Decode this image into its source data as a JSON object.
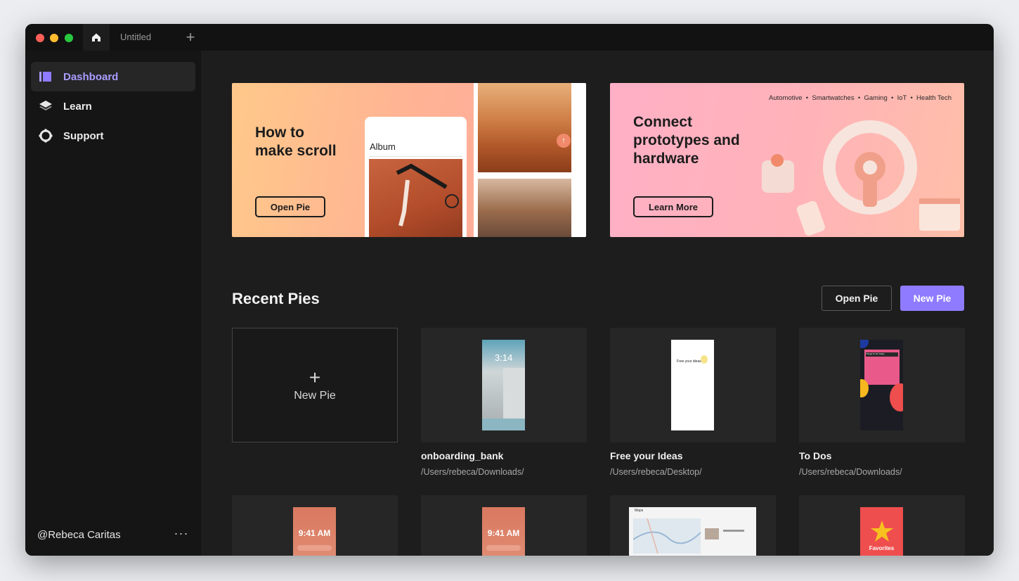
{
  "window": {
    "tab_title": "Untitled",
    "colors": {
      "close": "#ff5f57",
      "minimize": "#febc2e",
      "zoom": "#28c840",
      "accent": "#8e7bff"
    }
  },
  "sidebar": {
    "items": [
      {
        "label": "Dashboard",
        "icon": "dashboard-icon",
        "active": true
      },
      {
        "label": "Learn",
        "icon": "layers-icon",
        "active": false
      },
      {
        "label": "Support",
        "icon": "lifebuoy-icon",
        "active": false
      }
    ],
    "user": "@Rebeca Caritas",
    "more": "···"
  },
  "banners": [
    {
      "title_line1": "How to",
      "title_line2": "make scroll",
      "button": "Open Pie",
      "album_label": "Album"
    },
    {
      "title_line1": "Connect",
      "title_line2": "prototypes and",
      "title_line3": "hardware",
      "button": "Learn More",
      "tags": "Automotive  •  Smartwatches  •  Gaming  •  IoT  •  Health Tech"
    }
  ],
  "recent": {
    "title": "Recent Pies",
    "open_button": "Open Pie",
    "new_button": "New Pie",
    "new_card_plus": "+",
    "new_card_label": "New Pie",
    "items": [
      {
        "name": "onboarding_bank",
        "path": "/Users/rebeca/Downloads/",
        "thumb_time": "3:14"
      },
      {
        "name": "Free your Ideas",
        "path": "/Users/rebeca/Desktop/",
        "thumb_text": "Free your ideas"
      },
      {
        "name": "To Dos",
        "path": "/Users/rebeca/Downloads/",
        "thumb_text": "Things To Do Today"
      }
    ],
    "second_row": [
      {
        "thumb_time": "9:41 AM"
      },
      {
        "thumb_time": "9:41 AM"
      },
      {
        "thumb_text": "Maps"
      },
      {
        "thumb_text": "Favorites"
      }
    ]
  }
}
